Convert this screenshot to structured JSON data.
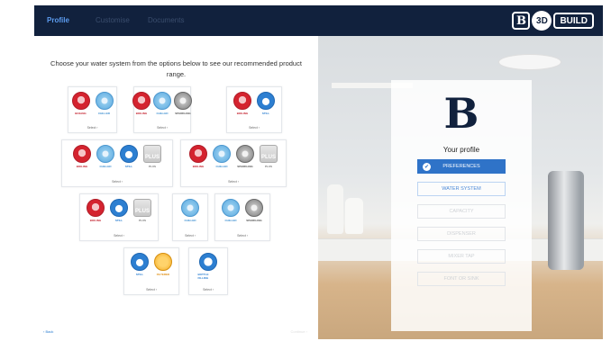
{
  "header": {
    "tabs": [
      {
        "label": "Profile"
      },
      {
        "label": "Customise"
      },
      {
        "label": "Documents"
      }
    ],
    "logo": {
      "b": "B",
      "threed": "3D",
      "build": "BUILD"
    }
  },
  "main": {
    "instruction": "Choose your water system from the options below to see our recommended product range.",
    "select_label": "Select",
    "options": [
      {
        "icons": [
          {
            "type": "boiling",
            "label": "BOILING"
          },
          {
            "type": "chilled",
            "label": "CHILLED"
          }
        ]
      },
      {
        "icons": [
          {
            "type": "boiling",
            "label": "BOILING"
          },
          {
            "type": "chilled",
            "label": "CHILLED"
          },
          {
            "type": "sparkling",
            "label": "SPARKLING"
          }
        ]
      },
      {
        "icons": [
          {
            "type": "boiling",
            "label": "BOILING"
          },
          {
            "type": "still",
            "label": "STILL"
          }
        ]
      },
      {
        "icons": [
          {
            "type": "boiling",
            "label": "BOILING"
          },
          {
            "type": "chilled",
            "label": "CHILLED"
          },
          {
            "type": "still",
            "label": "STILL"
          },
          {
            "type": "plus",
            "label": "PLUS"
          }
        ]
      },
      {
        "icons": [
          {
            "type": "boiling",
            "label": "BOILING"
          },
          {
            "type": "chilled",
            "label": "CHILLED"
          },
          {
            "type": "sparkling",
            "label": "SPARKLING"
          },
          {
            "type": "plus",
            "label": "PLUS"
          }
        ]
      },
      {
        "icons": [
          {
            "type": "boiling",
            "label": "BOILING"
          },
          {
            "type": "still",
            "label": "STILL"
          },
          {
            "type": "plus",
            "label": "PLUS"
          }
        ]
      },
      {
        "icons": [
          {
            "type": "chilled",
            "label": "CHILLED"
          }
        ]
      },
      {
        "icons": [
          {
            "type": "chilled",
            "label": "CHILLED"
          },
          {
            "type": "sparkling",
            "label": "SPARKLING"
          }
        ]
      },
      {
        "icons": [
          {
            "type": "still",
            "label": "STILL"
          },
          {
            "type": "filtered",
            "label": "FILTERED"
          }
        ]
      },
      {
        "icons": [
          {
            "type": "bottle",
            "label": "BOTTLE FILLING"
          }
        ]
      }
    ],
    "back_label": "Back",
    "continue_label": "Continue"
  },
  "profile_panel": {
    "logo_letter": "B",
    "title": "Your profile",
    "steps": [
      {
        "label": "PREFERENCES",
        "state": "active"
      },
      {
        "label": "WATER SYSTEM",
        "state": "current"
      },
      {
        "label": "CAPACITY",
        "state": "disabled"
      },
      {
        "label": "DISPENSER",
        "state": "disabled"
      },
      {
        "label": "MIXER TAP",
        "state": "disabled"
      },
      {
        "label": "FONT OR SINK",
        "state": "disabled"
      }
    ]
  },
  "colors": {
    "header_bg": "#11213d",
    "accent": "#2f73c8",
    "boiling": "#d4232f",
    "chilled": "#5aa8df",
    "still": "#2d7fd1",
    "filtered": "#f2a81d"
  }
}
